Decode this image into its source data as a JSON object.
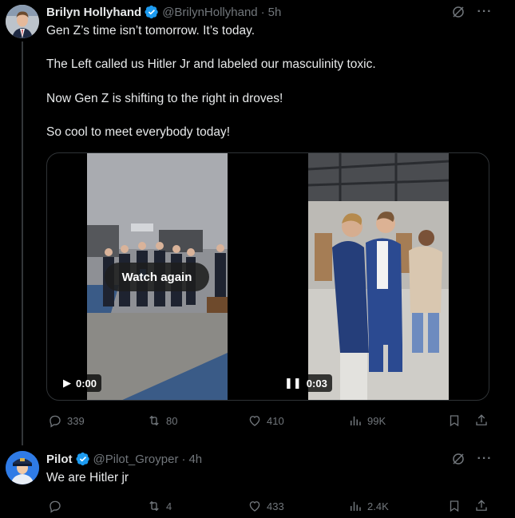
{
  "tweets": [
    {
      "name": "Brilyn Hollyhand",
      "handle": "@BrilynHollyhand",
      "dot": "·",
      "time": "5h",
      "more": "···",
      "lines": [
        "Gen Z’s time isn’t tomorrow. It’s today.",
        "The Left called us Hitler Jr and labeled our masculinity toxic.",
        "Now Gen Z is shifting to the right in droves!",
        "So cool to meet everybody today!"
      ],
      "media": {
        "video1_time": "0:00",
        "video2_time": "0:03",
        "watch_again": "Watch again"
      },
      "stats": {
        "replies": "339",
        "reposts": "80",
        "likes": "410",
        "views": "99K"
      }
    },
    {
      "name": "Pilot",
      "handle": "@Pilot_Groyper",
      "dot": "·",
      "time": "4h",
      "more": "···",
      "lines": [
        "We are Hitler jr"
      ],
      "stats": {
        "replies": "",
        "reposts": "4",
        "likes": "433",
        "views": "2.4K"
      }
    }
  ],
  "colors": {
    "background": "#000000",
    "text": "#e7e9ea",
    "muted": "#71767b",
    "verified": "#1d9bf0",
    "border": "#2f3336"
  }
}
